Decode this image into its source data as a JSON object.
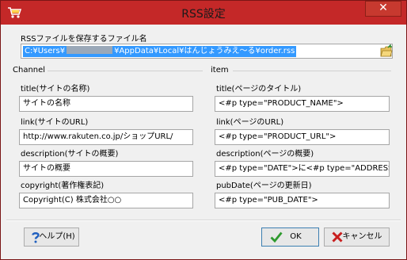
{
  "window": {
    "title": "RSS設定"
  },
  "file": {
    "label": "RSSファイルを保存するファイル名",
    "path_prefix": "C:¥Users¥",
    "path_suffix": "¥AppData¥Local¥はんじょうみえ〜る¥order.rss"
  },
  "channel": {
    "legend": "Channel",
    "fields": [
      {
        "label": "title(サイトの名称)",
        "value": "サイトの名称"
      },
      {
        "label": "link(サイトのURL)",
        "value": "http://www.rakuten.co.jp/ショップURL/"
      },
      {
        "label": "description(サイトの概要)",
        "value": "サイトの概要"
      },
      {
        "label": "copyright(著作権表記)",
        "value": "Copyright(C) 株式会社○○"
      }
    ]
  },
  "item": {
    "legend": "item",
    "fields": [
      {
        "label": "title(ページのタイトル)",
        "value": "<#p type=\"PRODUCT_NAME\">"
      },
      {
        "label": "link(ページのURL)",
        "value": "<#p type=\"PRODUCT_URL\">"
      },
      {
        "label": "description(ページの概要)",
        "value": "<#p type=\"DATE\">に<#p type=\"ADDRESS"
      },
      {
        "label": "pubDate(ページの更新日)",
        "value": "<#p type=\"PUB_DATE\">"
      }
    ]
  },
  "buttons": {
    "help": "ヘルプ(H)",
    "ok": "OK",
    "cancel": "キャンセル"
  },
  "colors": {
    "titlebar": "#c42828",
    "selection": "#3399ff",
    "close": "#c7392f"
  }
}
